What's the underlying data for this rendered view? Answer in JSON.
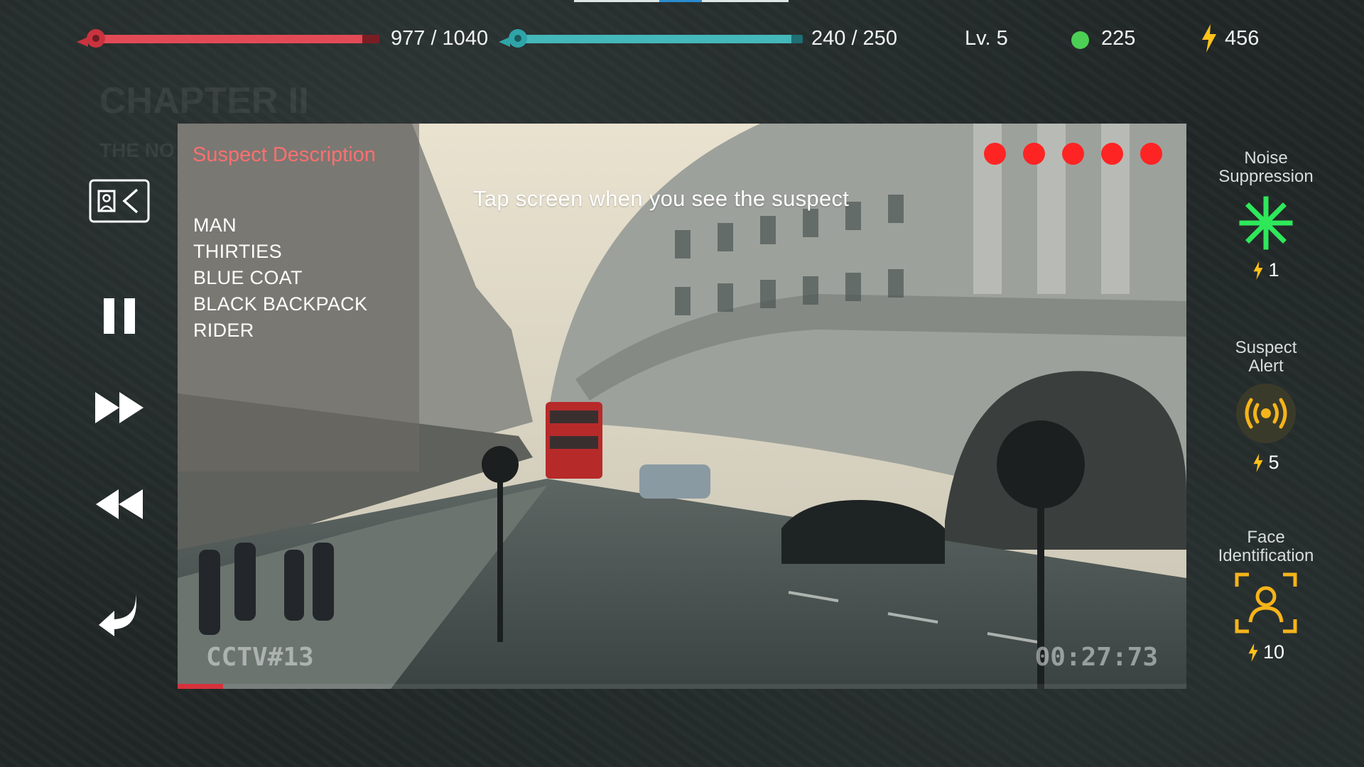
{
  "hud": {
    "hp": {
      "current": "977",
      "max": "1040",
      "label": "977 / 1040",
      "fraction": 0.94
    },
    "energy": {
      "current": "240",
      "max": "250",
      "label": "240 / 250",
      "fraction": 0.96
    },
    "level": "Lv. 5",
    "coins": "225",
    "power_points": "456",
    "colors": {
      "hp": "#e24a56",
      "energy": "#44b8ba",
      "coin": "#4ccf55",
      "bolt": "#ffc21a"
    }
  },
  "background": {
    "chapter_title": "CHAPTER II",
    "chapter_subtitle": "THE NO"
  },
  "left_controls": [
    {
      "name": "suspect-description-toggle-button",
      "icon": "id-card-back-icon"
    },
    {
      "name": "pause-button",
      "icon": "pause-icon"
    },
    {
      "name": "fast-forward-button",
      "icon": "fast-forward-icon"
    },
    {
      "name": "rewind-button",
      "icon": "rewind-icon"
    },
    {
      "name": "back-button",
      "icon": "return-arrow-icon"
    }
  ],
  "video": {
    "description_title": "Suspect Description",
    "description_items": [
      "MAN",
      "THIRTIES",
      "BLUE COAT",
      "BLACK BACKPACK",
      "RIDER"
    ],
    "instruction": "Tap screen when you see the suspect",
    "lives_remaining": 5,
    "camera_label": "CCTV#13",
    "timestamp": "00:27:73",
    "playback_progress": 0.045
  },
  "powers": [
    {
      "label_line1": "Noise",
      "label_line2": "Suppression",
      "icon": "noise-suppression-icon",
      "cost": "1"
    },
    {
      "label_line1": "Suspect",
      "label_line2": "Alert",
      "icon": "alert-broadcast-icon",
      "cost": "5"
    },
    {
      "label_line1": "Face",
      "label_line2": "Identification",
      "icon": "face-identification-icon",
      "cost": "10"
    }
  ]
}
